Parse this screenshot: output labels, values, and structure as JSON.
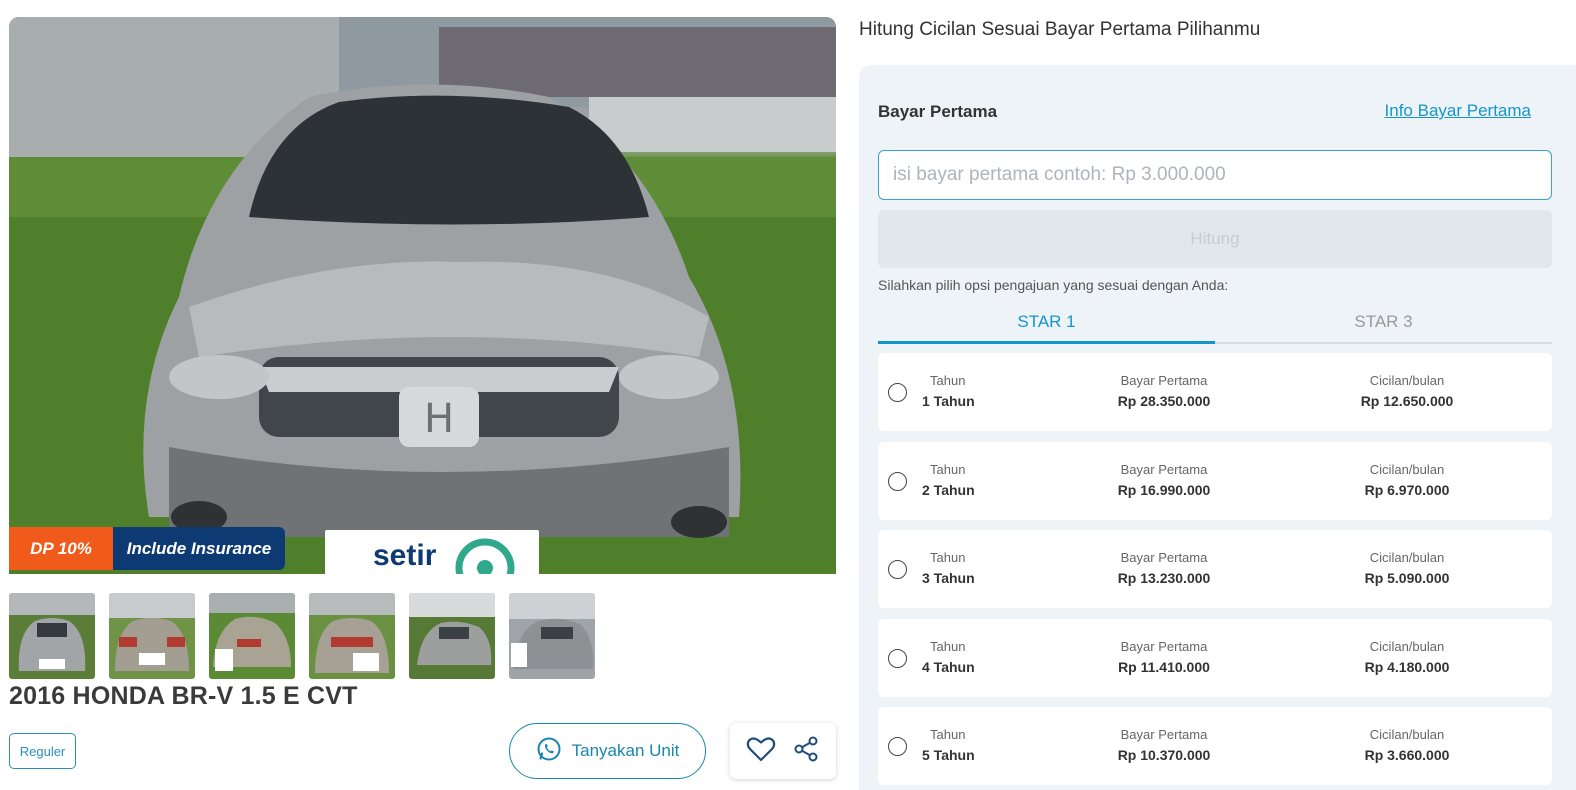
{
  "listing": {
    "badges": {
      "dp": "DP 10%",
      "insurance": "Include Insurance"
    },
    "watermark": "setir kanan",
    "title": "2016 HONDA BR-V 1.5 E CVT",
    "tag": "Reguler",
    "ask_button": "Tanyakan Unit",
    "thumbnail_count": 6
  },
  "calculator": {
    "heading": "Hitung Cicilan Sesuai Bayar Pertama Pilihanmu",
    "dp_label": "Bayar Pertama",
    "dp_info_link": "Info Bayar Pertama",
    "dp_input_value": "",
    "dp_input_placeholder": "isi bayar pertama contoh: Rp 3.000.000",
    "submit_label": "Hitung",
    "choose_text": "Silahkan pilih opsi pengajuan yang sesuai dengan Anda:",
    "tabs": [
      {
        "label": "STAR 1",
        "active": true
      },
      {
        "label": "STAR 3",
        "active": false
      }
    ],
    "col_labels": {
      "year": "Tahun",
      "dp": "Bayar Pertama",
      "installment": "Cicilan/bulan"
    },
    "plans": [
      {
        "year": "1 Tahun",
        "dp": "Rp 28.350.000",
        "installment": "Rp 12.650.000"
      },
      {
        "year": "2 Tahun",
        "dp": "Rp 16.990.000",
        "installment": "Rp 6.970.000"
      },
      {
        "year": "3 Tahun",
        "dp": "Rp 13.230.000",
        "installment": "Rp 5.090.000"
      },
      {
        "year": "4 Tahun",
        "dp": "Rp 11.410.000",
        "installment": "Rp 4.180.000"
      },
      {
        "year": "5 Tahun",
        "dp": "Rp 10.370.000",
        "installment": "Rp 3.660.000"
      }
    ]
  },
  "colors": {
    "accent": "#1596c9",
    "dp_badge": "#f05a1a",
    "insurance_badge": "#0d3a73",
    "panel_bg": "#eef3f8"
  },
  "icons": [
    "whatsapp-icon",
    "heart-icon",
    "share-icon",
    "radio-button"
  ]
}
